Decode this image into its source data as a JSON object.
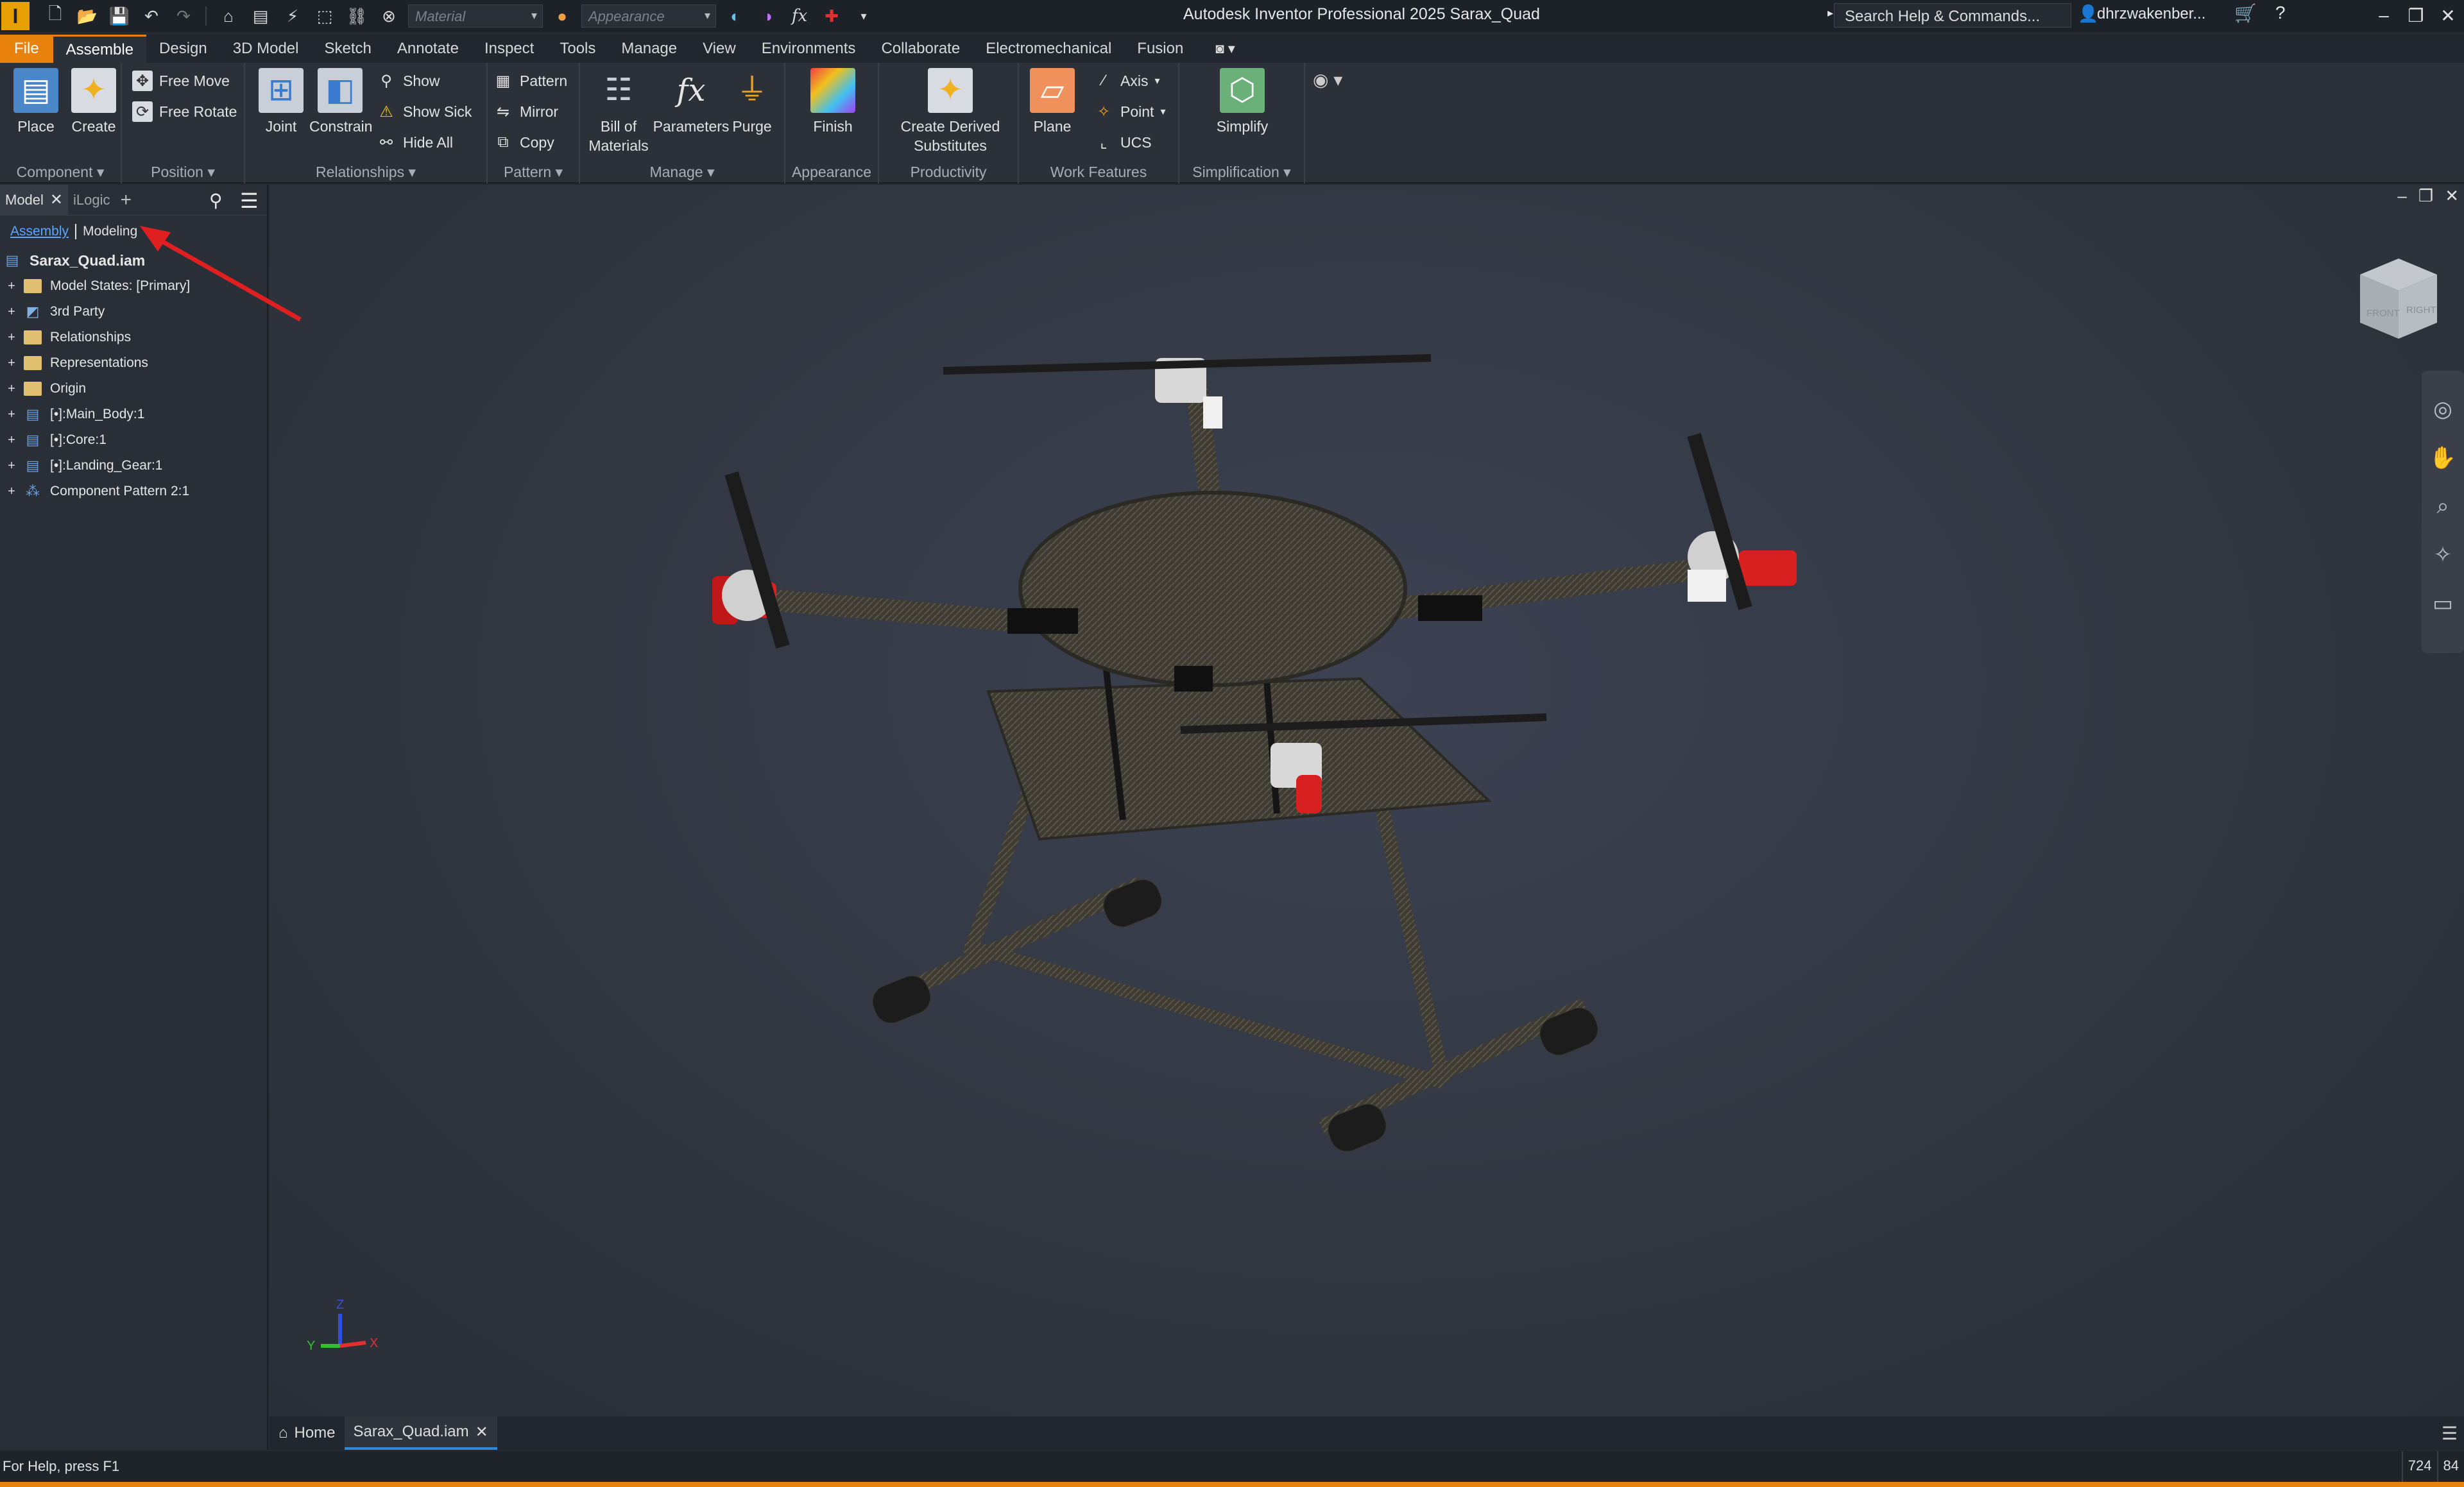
{
  "app": {
    "title": "Autodesk Inventor Professional 2025   Sarax_Quad",
    "logo": "I"
  },
  "qat": {
    "material_placeholder": "Material",
    "appearance_placeholder": "Appearance",
    "fx_label": "fx"
  },
  "search": {
    "label": "Search Help & Commands..."
  },
  "user": {
    "name": "dhrzwakenber..."
  },
  "ribbon_tabs": [
    "File",
    "Assemble",
    "Design",
    "3D Model",
    "Sketch",
    "Annotate",
    "Inspect",
    "Tools",
    "Manage",
    "View",
    "Environments",
    "Collaborate",
    "Electromechanical",
    "Fusion"
  ],
  "ribbon": {
    "component": {
      "label": "Component ▾",
      "place": "Place",
      "create": "Create"
    },
    "position": {
      "label": "Position ▾",
      "free_move": "Free Move",
      "free_rotate": "Free Rotate"
    },
    "relationships": {
      "label": "Relationships ▾",
      "joint": "Joint",
      "constrain": "Constrain",
      "show": "Show",
      "show_sick": "Show Sick",
      "hide_all": "Hide All"
    },
    "pattern": {
      "label": "Pattern ▾",
      "pattern": "Pattern",
      "mirror": "Mirror",
      "copy": "Copy"
    },
    "manage": {
      "label": "Manage ▾",
      "bom_line1": "Bill of",
      "bom_line2": "Materials",
      "parameters": "Parameters",
      "purge": "Purge"
    },
    "appearance": {
      "label": "Appearance",
      "finish": "Finish"
    },
    "productivity": {
      "label": "Productivity",
      "cds_line1": "Create Derived",
      "cds_line2": "Substitutes"
    },
    "work_features": {
      "label": "Work Features",
      "plane": "Plane",
      "axis": "Axis",
      "point": "Point",
      "ucs": "UCS"
    },
    "simplification": {
      "label": "Simplification ▾",
      "simplify": "Simplify"
    }
  },
  "browser": {
    "tabs": {
      "model": "Model",
      "ilogic": "iLogic"
    },
    "sub": {
      "assembly": "Assembly",
      "modeling": "Modeling"
    },
    "root": "Sarax_Quad.iam",
    "items": [
      "Model States: [Primary]",
      "3rd Party",
      "Relationships",
      "Representations",
      "Origin",
      "[•]:Main_Body:1",
      "[•]:Core:1",
      "[•]:Landing_Gear:1",
      "Component Pattern 2:1"
    ]
  },
  "viewcube": {
    "front": "FRONT",
    "right": "RIGHT"
  },
  "triad": {
    "x": "X",
    "y": "Y",
    "z": "Z"
  },
  "doc_tabs": {
    "home": "Home",
    "active": "Sarax_Quad.iam"
  },
  "status": {
    "help": "For Help, press F1",
    "n1": "724",
    "n2": "84"
  },
  "colors": {
    "accent": "#e8820c",
    "link": "#5aa6ff",
    "annotation_arrow": "#e02020"
  }
}
